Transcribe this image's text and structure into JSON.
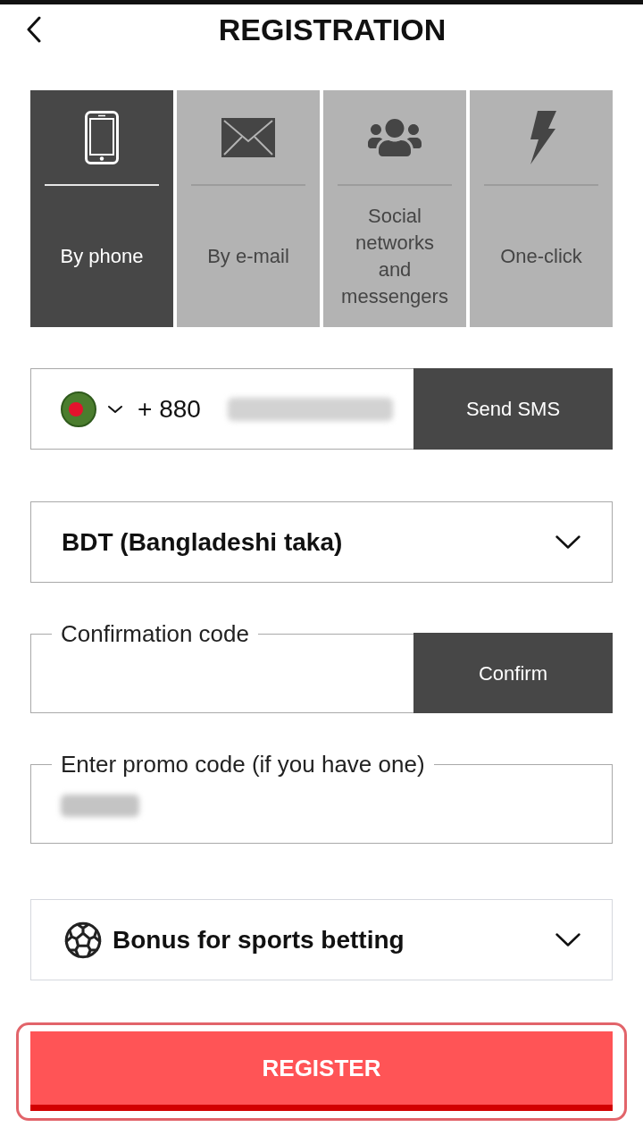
{
  "header": {
    "title": "REGISTRATION"
  },
  "tabs": [
    {
      "label": "By phone",
      "selected": true
    },
    {
      "label": "By e-mail",
      "selected": false
    },
    {
      "label": "Social networks and messengers",
      "selected": false
    },
    {
      "label": "One-click",
      "selected": false
    }
  ],
  "phone": {
    "country_code": "+ 880",
    "button": "Send SMS"
  },
  "currency": {
    "value": "BDT (Bangladeshi taka)"
  },
  "confirmation_code": {
    "label": "Confirmation code",
    "button": "Confirm"
  },
  "promo_code": {
    "label": "Enter promo code (if you have one)"
  },
  "bonus": {
    "value": "Bonus for sports betting"
  },
  "register_button": {
    "label": "REGISTER"
  }
}
